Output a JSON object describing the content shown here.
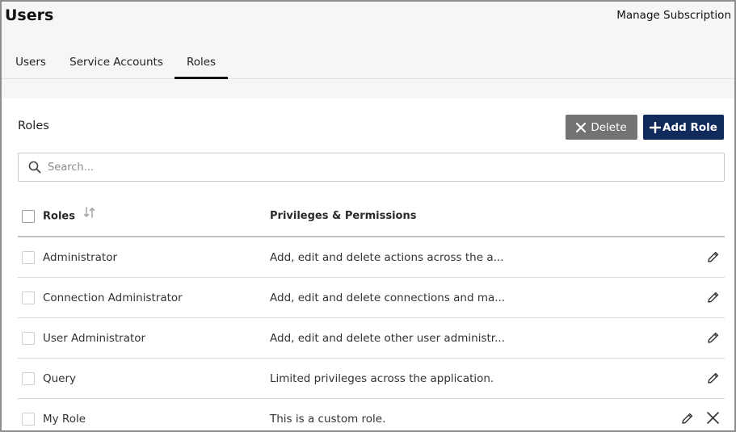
{
  "header": {
    "title": "Users",
    "manage_subscription": "Manage Subscription"
  },
  "tabs": [
    {
      "label": "Users",
      "active": false
    },
    {
      "label": "Service Accounts",
      "active": false
    },
    {
      "label": "Roles",
      "active": true
    }
  ],
  "section": {
    "title": "Roles",
    "delete_label": "Delete",
    "add_label": "Add Role"
  },
  "search": {
    "placeholder": "Search...",
    "value": ""
  },
  "table": {
    "columns": [
      "Roles",
      "Privileges & Permissions"
    ],
    "rows": [
      {
        "role": "Administrator",
        "privileges": "Add, edit and delete actions across the a...",
        "deletable": false
      },
      {
        "role": "Connection Administrator",
        "privileges": "Add, edit and delete connections and ma...",
        "deletable": false
      },
      {
        "role": "User Administrator",
        "privileges": "Add, edit and delete other user administr...",
        "deletable": false
      },
      {
        "role": "Query",
        "privileges": "Limited privileges across the application.",
        "deletable": false
      },
      {
        "role": "My Role",
        "privileges": "This is a custom role.",
        "deletable": true
      }
    ]
  },
  "colors": {
    "delete_button": "#737373",
    "add_button": "#102a5c",
    "header_background": "#f8f6f4"
  },
  "icons": [
    "search-icon",
    "sort-icon",
    "pencil-icon",
    "close-icon",
    "plus-icon",
    "x-icon"
  ]
}
